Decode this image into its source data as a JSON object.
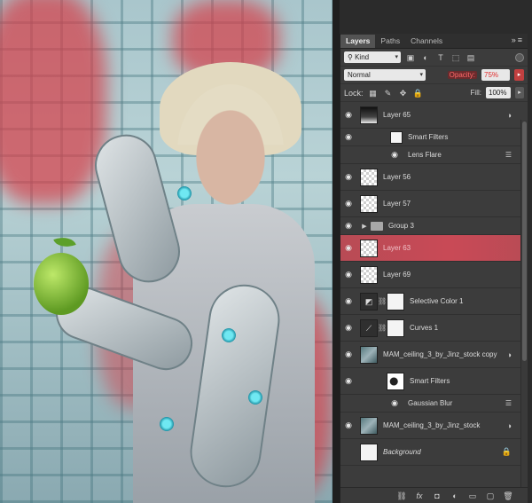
{
  "panel": {
    "tabs": [
      "Layers",
      "Paths",
      "Channels"
    ],
    "active_tab": "Layers",
    "filter_label": "Kind",
    "blend_mode": "Normal",
    "opacity_label": "Opacity:",
    "opacity_value": "75%",
    "lock_label": "Lock:",
    "fill_label": "Fill:",
    "fill_value": "100%"
  },
  "layers": [
    {
      "name": "Layer 65",
      "type": "smart"
    },
    {
      "name": "Smart Filters",
      "type": "sub-header"
    },
    {
      "name": "Lens Flare",
      "type": "sub-filter"
    },
    {
      "name": "Layer 56",
      "type": "layer"
    },
    {
      "name": "Layer 57",
      "type": "layer"
    },
    {
      "name": "Group 3",
      "type": "group"
    },
    {
      "name": "Layer 63",
      "type": "layer",
      "selected": true
    },
    {
      "name": "Layer 69",
      "type": "layer"
    },
    {
      "name": "Selective Color 1",
      "type": "adjustment"
    },
    {
      "name": "Curves 1",
      "type": "adjustment"
    },
    {
      "name": "MAM_ceiling_3_by_Jinz_stock copy",
      "type": "smart"
    },
    {
      "name": "Smart Filters",
      "type": "sub-header"
    },
    {
      "name": "Gaussian Blur",
      "type": "sub-filter"
    },
    {
      "name": "MAM_ceiling_3_by_Jinz_stock",
      "type": "smart"
    },
    {
      "name": "Background",
      "type": "background"
    }
  ],
  "bottom_icons": [
    "link-icon",
    "fx-icon",
    "mask-icon",
    "adjustment-icon",
    "group-icon",
    "new-layer-icon",
    "trash-icon"
  ],
  "colors": {
    "selection": "#c94a56",
    "panel_bg": "#3c3c3c",
    "opacity_highlight": "#e02a2a"
  }
}
